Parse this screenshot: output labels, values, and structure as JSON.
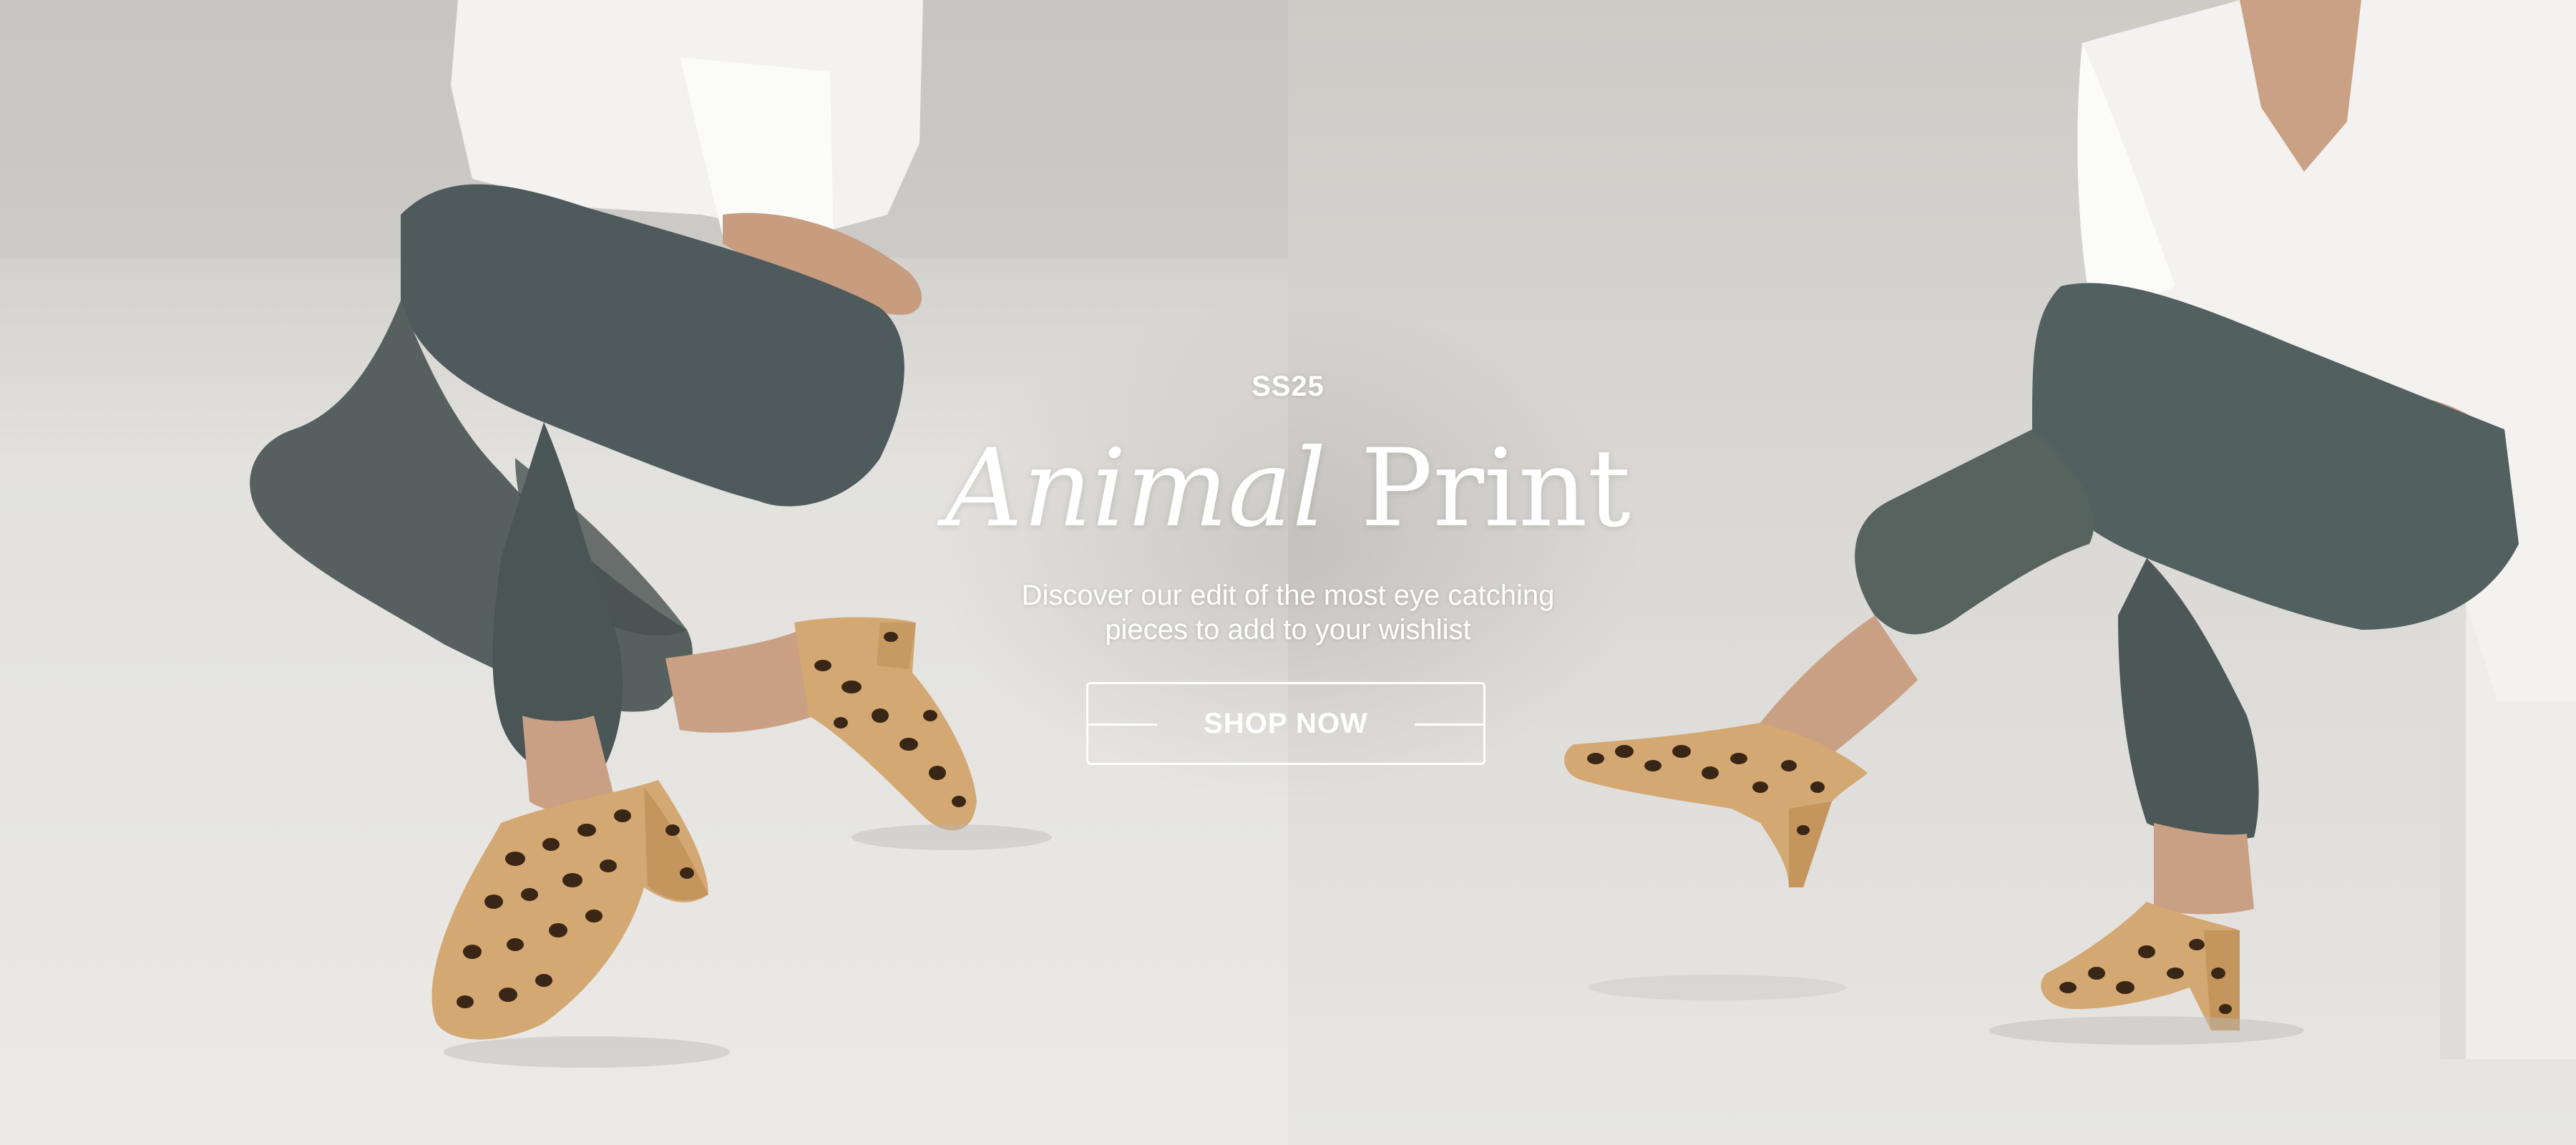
{
  "hero": {
    "eyebrow": "SS25",
    "title_italic": "Animal",
    "title_regular": "Print",
    "subtitle_line1": "Discover our edit of the most eye catching",
    "subtitle_line2": "pieces to add to your wishlist",
    "cta_label": "SHOP NOW"
  },
  "colors": {
    "text": "#ffffff",
    "background_left": "#e2e1de",
    "background_right": "#dfddda",
    "denim": "#4f5a5c",
    "shirt": "#f3f2f0",
    "leopard_base": "#d3a872",
    "leopard_spot": "#3a2616"
  }
}
